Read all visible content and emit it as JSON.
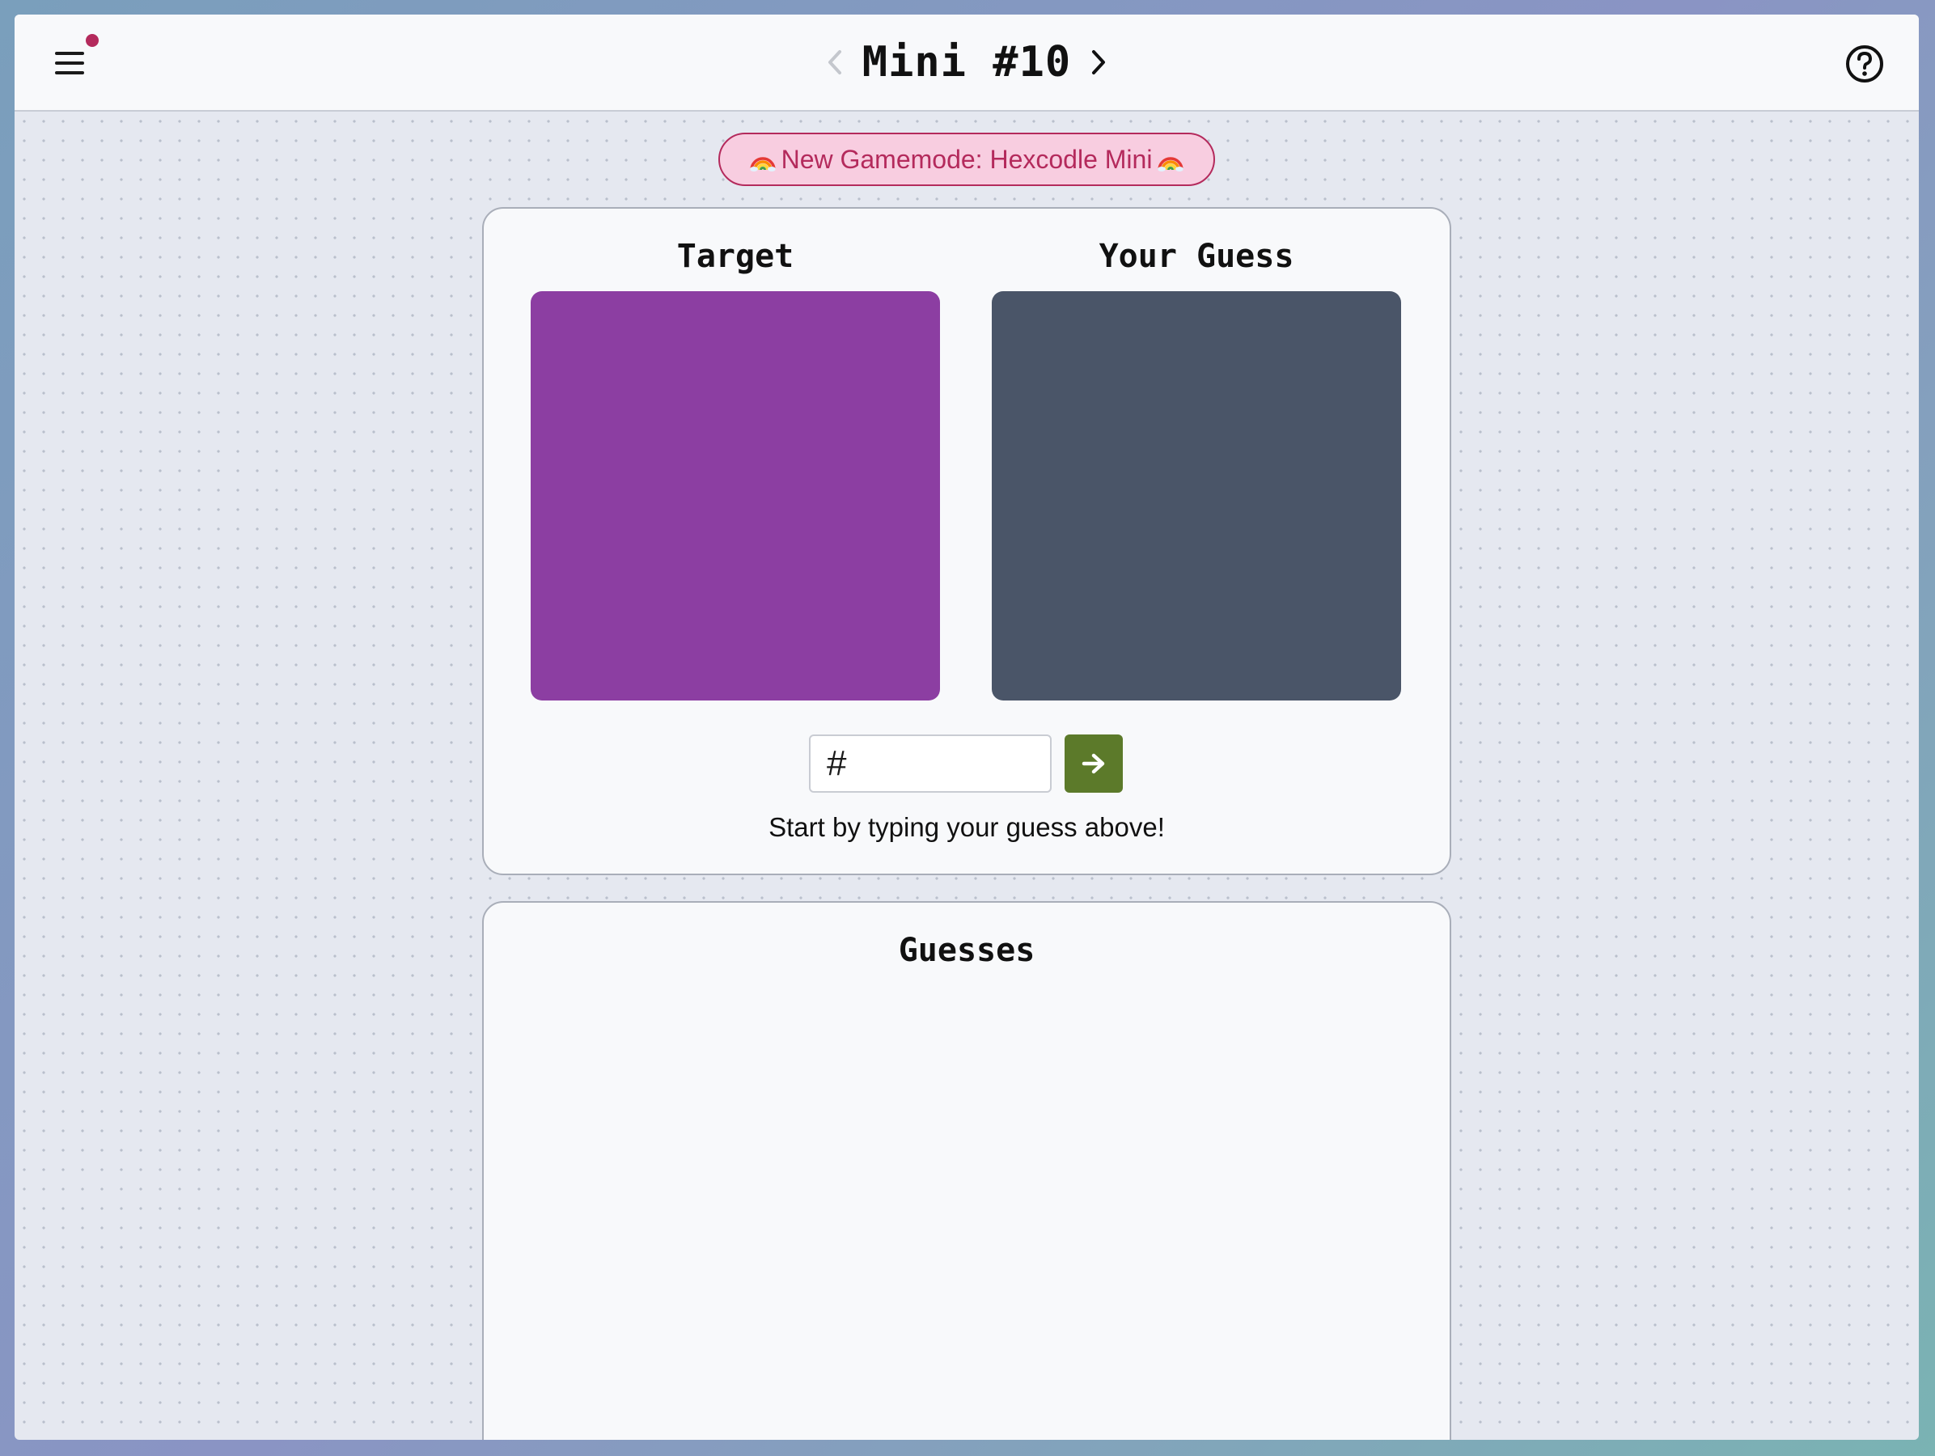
{
  "header": {
    "title": "Mini #10",
    "notification": true
  },
  "banner": {
    "text": "New Gamemode: Hexcodle Mini",
    "icon": "rainbow-icon"
  },
  "game": {
    "target_label": "Target",
    "guess_label": "Your Guess",
    "target_color": "#8c3ea2",
    "guess_color": "#4a5568",
    "input": {
      "value": "#",
      "placeholder": ""
    },
    "submit_icon": "arrow-right-icon",
    "hint": "Start by typing your guess above!"
  },
  "guesses": {
    "title": "Guesses",
    "items": []
  },
  "colors": {
    "accent": "#b42a5c",
    "banner_bg": "#f8cde0",
    "submit_bg": "#5c7a2a"
  }
}
